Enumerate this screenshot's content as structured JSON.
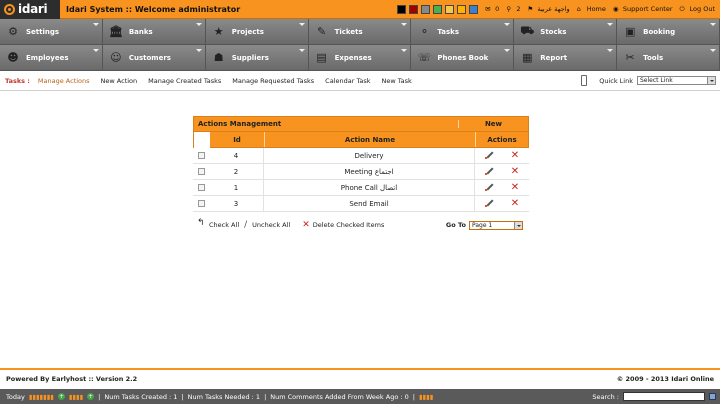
{
  "header": {
    "logo_text": "idari",
    "title": "Idari System :: Welcome administrator",
    "colors": [
      "#000000",
      "#a00000",
      "#888888",
      "#4caf50",
      "#f7c64a",
      "#ffb300",
      "#3f7fd0"
    ],
    "messages_count": "0",
    "alerts_count": "2",
    "language_label": "واجهة عربية",
    "home_label": "Home",
    "support_label": "Support Center",
    "logout_label": "Log Out"
  },
  "nav": {
    "items": [
      {
        "label": "Settings",
        "icon": "wrench-icon"
      },
      {
        "label": "Banks",
        "icon": "bank-icon"
      },
      {
        "label": "Projects",
        "icon": "star-icon"
      },
      {
        "label": "Tickets",
        "icon": "ticket-icon"
      },
      {
        "label": "Tasks",
        "icon": "network-icon"
      },
      {
        "label": "Stocks",
        "icon": "truck-icon"
      },
      {
        "label": "Booking",
        "icon": "booking-icon"
      },
      {
        "label": "Employees",
        "icon": "employees-icon"
      },
      {
        "label": "Customers",
        "icon": "customers-icon"
      },
      {
        "label": "Suppliers",
        "icon": "suppliers-icon"
      },
      {
        "label": "Expenses",
        "icon": "briefcase-icon"
      },
      {
        "label": "Phones Book",
        "icon": "phone-icon"
      },
      {
        "label": "Report",
        "icon": "report-icon"
      },
      {
        "label": "Tools",
        "icon": "tools-icon"
      }
    ]
  },
  "subnav": {
    "lead": "Tasks :",
    "links": [
      "Manage Actions",
      "New Action",
      "Manage Created Tasks",
      "Manage Requested Tasks",
      "Calendar Task",
      "New Task"
    ],
    "quick_link_label": "Quick Link",
    "quick_link_value": "Select Link"
  },
  "table": {
    "title": "Actions Management",
    "new_label": "New",
    "columns": {
      "id": "Id",
      "name": "Action Name",
      "actions": "Actions"
    },
    "rows": [
      {
        "id": "4",
        "name": "Delivery"
      },
      {
        "id": "2",
        "name": "Meeting اجتماع"
      },
      {
        "id": "1",
        "name": "Phone Call اتصال"
      },
      {
        "id": "3",
        "name": "Send Email"
      }
    ]
  },
  "table_actions": {
    "check_all": "Check All",
    "uncheck_all": "Uncheck All",
    "delete_checked": "Delete Checked Items",
    "goto_label": "Go To",
    "page_value": "Page 1"
  },
  "footer": {
    "powered": "Powered By Earlyhost :: Version 2.2",
    "copyright": "© 2009 - 2013 Idari Online"
  },
  "statusbar": {
    "today_label": "Today",
    "num_tasks_created": "Num Tasks Created : 1",
    "num_tasks_needed": "Num Tasks Needed : 1",
    "num_comments": "Num Comments Added From Week Ago : 0",
    "search_label": "Search :"
  }
}
